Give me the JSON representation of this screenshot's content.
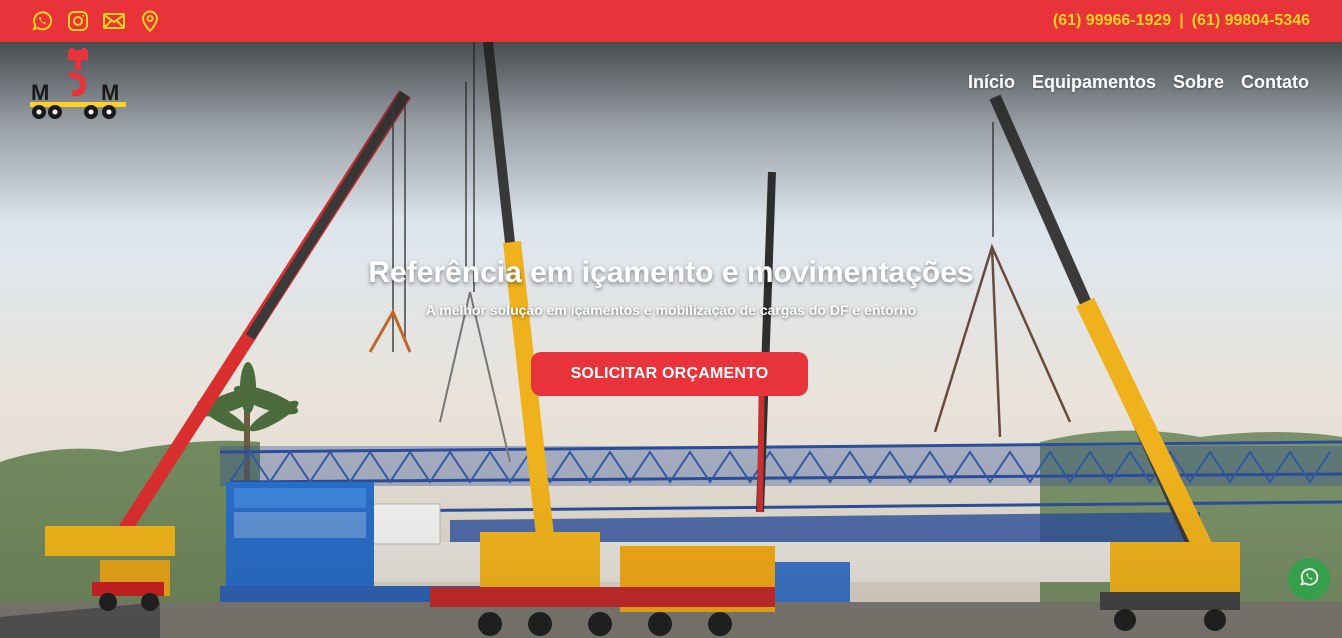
{
  "topbar": {
    "icons": [
      "whatsapp-icon",
      "instagram-icon",
      "email-icon",
      "location-icon"
    ],
    "phone_1": "(61) 99966-1929",
    "separator": "|",
    "phone_2": "(61) 99804-5346"
  },
  "nav": {
    "items": [
      "Início",
      "Equipamentos",
      "Sobre",
      "Contato"
    ]
  },
  "hero": {
    "title": "Referência em içamento e movimentações",
    "subtitle": "A melhor solução em içamentos e mobilização de cargas do DF e entorno",
    "cta_label": "SOLICITAR ORÇAMENTO"
  },
  "colors": {
    "brand_red": "#e8333a",
    "accent_yellow": "#ffd21f",
    "whatsapp_green": "#2fa24a"
  }
}
